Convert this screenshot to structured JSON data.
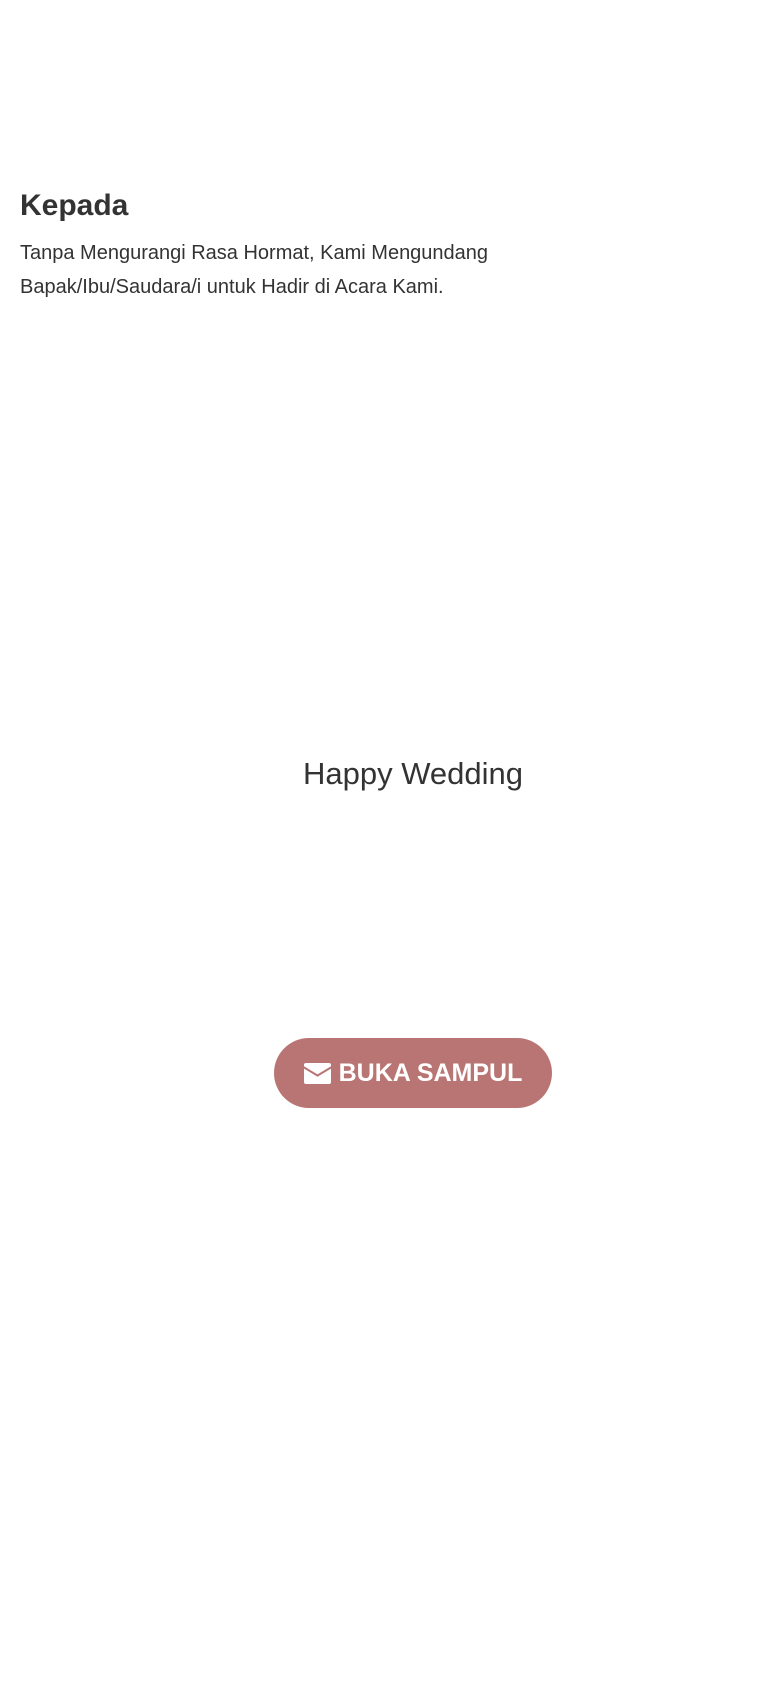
{
  "greeting": {
    "title": "Kepada",
    "line1": "Tanpa Mengurangi Rasa Hormat, Kami Mengundang",
    "line2": "Bapak/Ibu/Saudara/i untuk Hadir di Acara Kami."
  },
  "cover": {
    "title": "Happy Wedding"
  },
  "open_button": {
    "label": "BUKA SAMPUL",
    "icon": "envelope-icon",
    "color": "#b97573",
    "text_color": "#ffffff"
  }
}
